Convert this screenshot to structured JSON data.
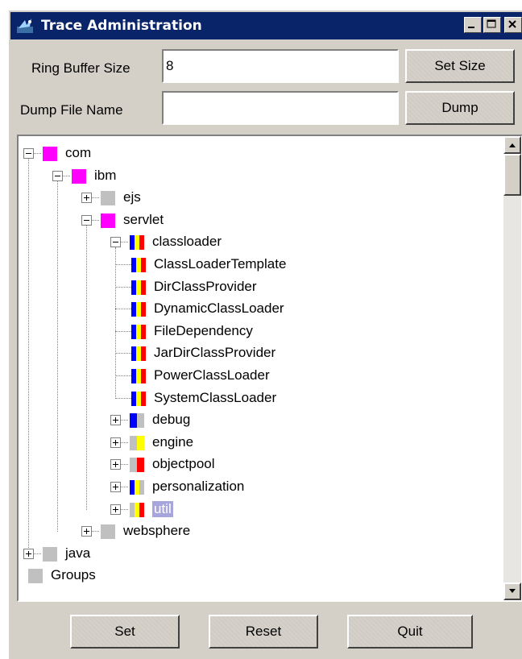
{
  "window": {
    "title": "Trace Administration",
    "controls": [
      "minimize",
      "maximize",
      "close"
    ]
  },
  "form": {
    "ring_buffer_label": "Ring Buffer Size",
    "ring_buffer_value": "8",
    "set_size_label": "Set Size",
    "dump_file_label": "Dump File Name",
    "dump_file_value": "",
    "dump_label": "Dump"
  },
  "tree": {
    "nodes": [
      {
        "label": "com",
        "icon": "state-magenta"
      },
      {
        "label": "ibm",
        "icon": "state-magenta"
      },
      {
        "label": "ejs",
        "icon": "state-gray"
      },
      {
        "label": "servlet",
        "icon": "state-magenta"
      },
      {
        "label": "classloader",
        "icon": "state-blue-yellow-red"
      },
      {
        "label": "ClassLoaderTemplate",
        "icon": "state-blue-yellow-red"
      },
      {
        "label": "DirClassProvider",
        "icon": "state-blue-yellow-red"
      },
      {
        "label": "DynamicClassLoader",
        "icon": "state-blue-yellow-red"
      },
      {
        "label": "FileDependency",
        "icon": "state-blue-yellow-red"
      },
      {
        "label": "JarDirClassProvider",
        "icon": "state-blue-yellow-red"
      },
      {
        "label": "PowerClassLoader",
        "icon": "state-blue-yellow-red"
      },
      {
        "label": "SystemClassLoader",
        "icon": "state-blue-yellow-red"
      },
      {
        "label": "debug",
        "icon": "state-blue-gray"
      },
      {
        "label": "engine",
        "icon": "state-yellow"
      },
      {
        "label": "objectpool",
        "icon": "state-red"
      },
      {
        "label": "personalization",
        "icon": "state-blue-yellow"
      },
      {
        "label": "util",
        "icon": "state-yellow-red",
        "selected": true
      },
      {
        "label": "websphere",
        "icon": "state-gray"
      },
      {
        "label": "java",
        "icon": "state-gray"
      },
      {
        "label": "Groups",
        "icon": "state-gray"
      }
    ]
  },
  "buttons": {
    "set": "Set",
    "reset": "Reset",
    "quit": "Quit"
  },
  "colors": {
    "titlebar": "#0a246a",
    "face": "#d4d0c8",
    "magenta": "#ff00ff",
    "blue": "#0000ff",
    "yellow": "#ffff00",
    "red": "#ff0000",
    "gray": "#c0c0c0",
    "selection": "#a6a6dc"
  }
}
